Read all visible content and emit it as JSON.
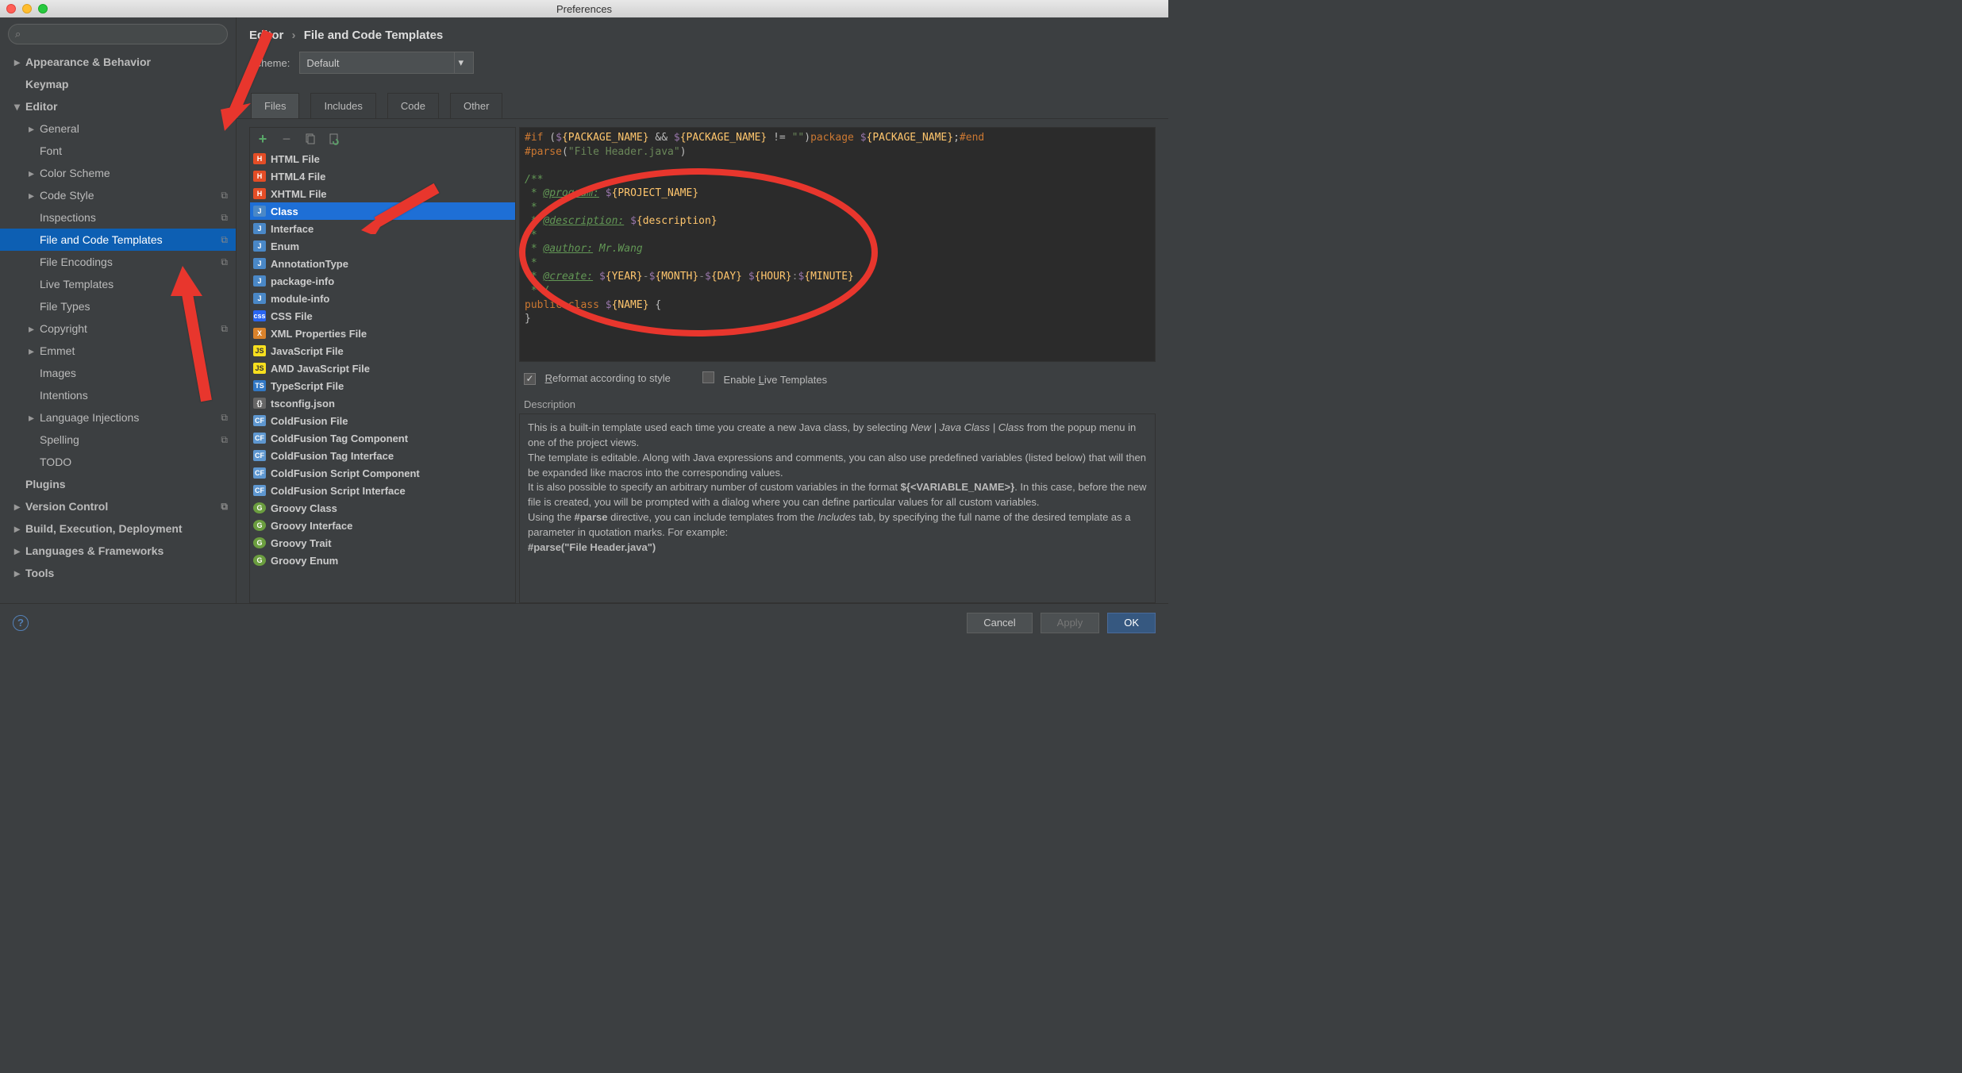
{
  "window": {
    "title": "Preferences"
  },
  "sidebar": {
    "search_placeholder": "",
    "items": [
      {
        "label": "Appearance & Behavior",
        "arrow": "closed",
        "level": 0
      },
      {
        "label": "Keymap",
        "arrow": "",
        "level": 0
      },
      {
        "label": "Editor",
        "arrow": "open",
        "level": 0
      },
      {
        "label": "General",
        "arrow": "closed",
        "level": 1
      },
      {
        "label": "Font",
        "arrow": "",
        "level": 1
      },
      {
        "label": "Color Scheme",
        "arrow": "closed",
        "level": 1
      },
      {
        "label": "Code Style",
        "arrow": "closed",
        "level": 1,
        "copy": true
      },
      {
        "label": "Inspections",
        "arrow": "",
        "level": 1,
        "copy": true
      },
      {
        "label": "File and Code Templates",
        "arrow": "",
        "level": 1,
        "copy": true,
        "selected": true
      },
      {
        "label": "File Encodings",
        "arrow": "",
        "level": 1,
        "copy": true
      },
      {
        "label": "Live Templates",
        "arrow": "",
        "level": 1
      },
      {
        "label": "File Types",
        "arrow": "",
        "level": 1
      },
      {
        "label": "Copyright",
        "arrow": "closed",
        "level": 1,
        "copy": true
      },
      {
        "label": "Emmet",
        "arrow": "closed",
        "level": 1
      },
      {
        "label": "Images",
        "arrow": "",
        "level": 1
      },
      {
        "label": "Intentions",
        "arrow": "",
        "level": 1
      },
      {
        "label": "Language Injections",
        "arrow": "closed",
        "level": 1,
        "copy": true
      },
      {
        "label": "Spelling",
        "arrow": "",
        "level": 1,
        "copy": true
      },
      {
        "label": "TODO",
        "arrow": "",
        "level": 1
      },
      {
        "label": "Plugins",
        "arrow": "",
        "level": 0
      },
      {
        "label": "Version Control",
        "arrow": "closed",
        "level": 0,
        "copy": true
      },
      {
        "label": "Build, Execution, Deployment",
        "arrow": "closed",
        "level": 0
      },
      {
        "label": "Languages & Frameworks",
        "arrow": "closed",
        "level": 0
      },
      {
        "label": "Tools",
        "arrow": "closed",
        "level": 0
      }
    ]
  },
  "breadcrumb": {
    "parent": "Editor",
    "current": "File and Code Templates"
  },
  "scheme": {
    "label": "Scheme:",
    "value": "Default"
  },
  "subtabs": [
    "Files",
    "Includes",
    "Code",
    "Other"
  ],
  "subtab_active": "Files",
  "templates": [
    {
      "label": "HTML File",
      "icon": "ic-html",
      "badge": "H"
    },
    {
      "label": "HTML4 File",
      "icon": "ic-html",
      "badge": "H"
    },
    {
      "label": "XHTML File",
      "icon": "ic-html",
      "badge": "H"
    },
    {
      "label": "Class",
      "icon": "ic-java",
      "badge": "J",
      "selected": true
    },
    {
      "label": "Interface",
      "icon": "ic-java",
      "badge": "J"
    },
    {
      "label": "Enum",
      "icon": "ic-java",
      "badge": "J"
    },
    {
      "label": "AnnotationType",
      "icon": "ic-java",
      "badge": "J"
    },
    {
      "label": "package-info",
      "icon": "ic-java",
      "badge": "J"
    },
    {
      "label": "module-info",
      "icon": "ic-java",
      "badge": "J"
    },
    {
      "label": "CSS File",
      "icon": "ic-css",
      "badge": "css"
    },
    {
      "label": "XML Properties File",
      "icon": "ic-xml",
      "badge": "X"
    },
    {
      "label": "JavaScript File",
      "icon": "ic-js",
      "badge": "JS"
    },
    {
      "label": "AMD JavaScript File",
      "icon": "ic-js",
      "badge": "JS"
    },
    {
      "label": "TypeScript File",
      "icon": "ic-ts",
      "badge": "TS"
    },
    {
      "label": "tsconfig.json",
      "icon": "ic-json",
      "badge": "{}"
    },
    {
      "label": "ColdFusion File",
      "icon": "ic-cf",
      "badge": "CF"
    },
    {
      "label": "ColdFusion Tag Component",
      "icon": "ic-cf",
      "badge": "CF"
    },
    {
      "label": "ColdFusion Tag Interface",
      "icon": "ic-cf",
      "badge": "CF"
    },
    {
      "label": "ColdFusion Script Component",
      "icon": "ic-cf",
      "badge": "CF"
    },
    {
      "label": "ColdFusion Script Interface",
      "icon": "ic-cf",
      "badge": "CF"
    },
    {
      "label": "Groovy Class",
      "icon": "ic-groovy",
      "badge": "G"
    },
    {
      "label": "Groovy Interface",
      "icon": "ic-groovy",
      "badge": "G"
    },
    {
      "label": "Groovy Trait",
      "icon": "ic-groovy",
      "badge": "G"
    },
    {
      "label": "Groovy Enum",
      "icon": "ic-groovy",
      "badge": "G"
    }
  ],
  "code": {
    "l1a": "#if",
    "l1b": " (",
    "l1c": "$",
    "l1d": "{PACKAGE_NAME}",
    "l1e": " && ",
    "l1f": "$",
    "l1g": "{PACKAGE_NAME}",
    "l1h": " != ",
    "l1i": "\"\"",
    "l1j": ")",
    "l1k": "package ",
    "l1l": "$",
    "l1m": "{PACKAGE_NAME}",
    "l1n": ";",
    "l1o": "#end",
    "l2a": "#parse",
    "l2b": "(",
    "l2c": "\"File Header.java\"",
    "l2d": ")",
    "l3": "/**",
    "l4a": " * ",
    "l4b": "@program:",
    "l4c": " ",
    "l4d": "$",
    "l4e": "{PROJECT_NAME}",
    "l5": " *",
    "l6a": " * ",
    "l6b": "@description:",
    "l6c": " ",
    "l6d": "$",
    "l6e": "{description}",
    "l7": " *",
    "l8a": " * ",
    "l8b": "@author:",
    "l8c": " Mr.Wang",
    "l9": " *",
    "l10a": " * ",
    "l10b": "@create:",
    "l10c": " ",
    "l10d": "$",
    "l10e": "{YEAR}",
    "l10f": "-",
    "l10g": "$",
    "l10h": "{MONTH}",
    "l10i": "-",
    "l10j": "$",
    "l10k": "{DAY}",
    "l10l": " ",
    "l10m": "$",
    "l10n": "{HOUR}",
    "l10o": ":",
    "l10p": "$",
    "l10q": "{MINUTE}",
    "l11": " **/",
    "l12a": "public class ",
    "l12b": "$",
    "l12c": "{NAME}",
    "l12d": " {",
    "l13": "}"
  },
  "checks": {
    "reformat": "Reformat according to style",
    "reformat_u": "R",
    "live": "Enable Live Templates",
    "live_u": "L"
  },
  "desc": {
    "label": "Description",
    "p1a": "This is a built-in template used each time you create a new Java class, by selecting ",
    "p1b": "New | Java Class | Class",
    "p1c": " from the popup menu in one of the project views.",
    "p2": "The template is editable. Along with Java expressions and comments, you can also use predefined variables (listed below) that will then be expanded like macros into the corresponding values.",
    "p3a": "It is also possible to specify an arbitrary number of custom variables in the format ",
    "p3b": "${<VARIABLE_NAME>}",
    "p3c": ". In this case, before the new file is created, you will be prompted with a dialog where you can define particular values for all custom variables.",
    "p4a": "Using the ",
    "p4b": "#parse",
    "p4c": " directive, you can include templates from the ",
    "p4d": "Includes",
    "p4e": " tab, by specifying the full name of the desired template as a parameter in quotation marks. For example:",
    "p5": "#parse(\"File Header.java\")"
  },
  "buttons": {
    "cancel": "Cancel",
    "apply": "Apply",
    "ok": "OK"
  }
}
